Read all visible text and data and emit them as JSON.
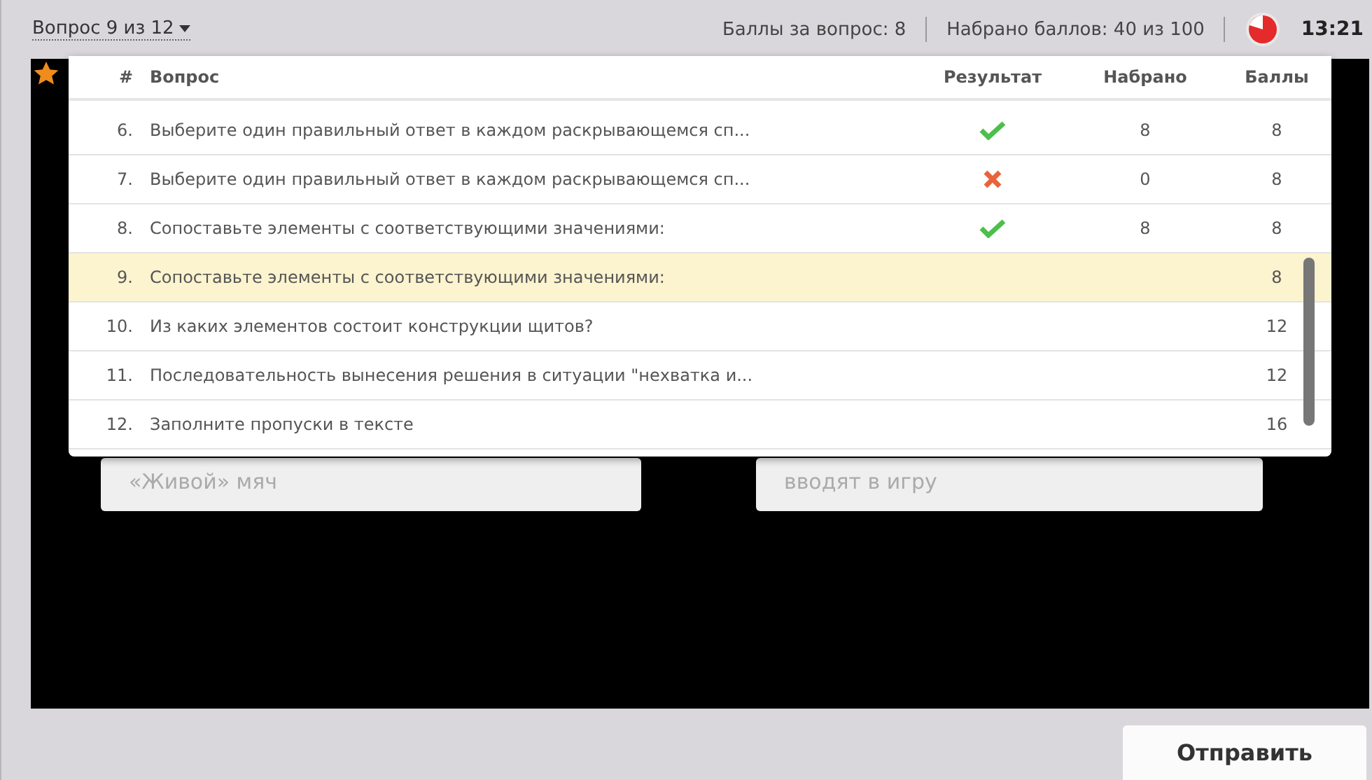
{
  "header": {
    "question_nav": "Вопрос 9 из 12",
    "points_per_question": "Баллы за вопрос: 8",
    "points_total": "Набрано баллов: 40 из 100",
    "timer": "13:21"
  },
  "cards": [
    {
      "text": "«Живой» мяч"
    },
    {
      "text": "вводят в игру"
    }
  ],
  "table": {
    "columns": [
      "#",
      "Вопрос",
      "Результат",
      "Набрано",
      "Баллы"
    ],
    "rows": [
      {
        "num": "6.",
        "question": "Выберите один правильный ответ в каждом раскрывающемся сп...",
        "kind": "correct",
        "scored": "8",
        "points": "8",
        "selected": false
      },
      {
        "num": "7.",
        "question": "Выберите один правильный ответ в каждом раскрывающемся сп...",
        "kind": "wrong",
        "scored": "0",
        "points": "8",
        "selected": false
      },
      {
        "num": "8.",
        "question": "Сопоставьте элементы с соответствующими значениями:",
        "kind": "correct",
        "scored": "8",
        "points": "8",
        "selected": false
      },
      {
        "num": "9.",
        "question": "Сопоставьте элементы с соответствующими значениями:",
        "kind": "none",
        "points": "8",
        "selected": true
      },
      {
        "num": "10.",
        "question": "Из каких элементов состоит конструкции щитов?",
        "kind": "none",
        "points": "12",
        "selected": false
      },
      {
        "num": "11.",
        "question": "Последовательность вынесения решения в ситуации \"нехватка и...",
        "kind": "none",
        "points": "12",
        "selected": false
      },
      {
        "num": "12.",
        "question": "Заполните пропуски в тексте",
        "kind": "none",
        "points": "16",
        "selected": false
      }
    ]
  },
  "submit_button": "Отправить"
}
